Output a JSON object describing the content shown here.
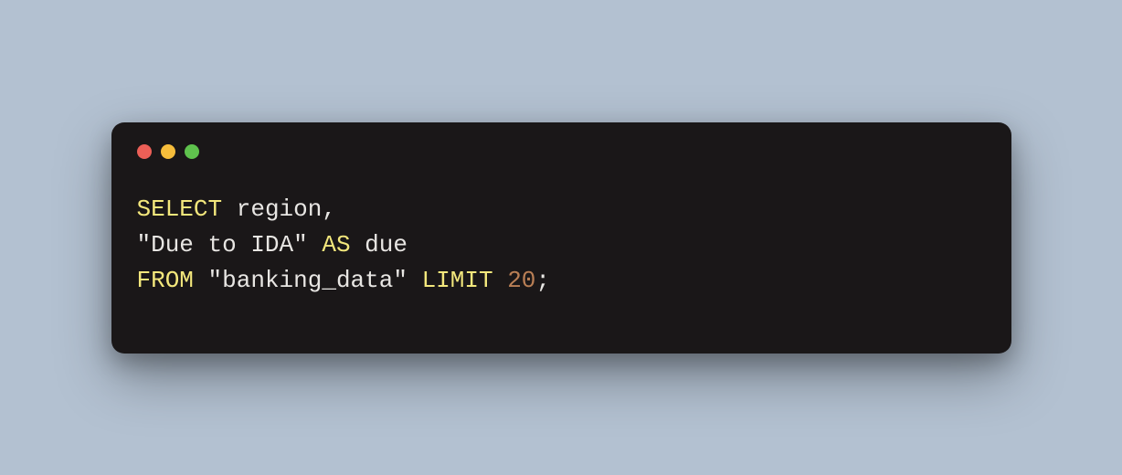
{
  "window": {
    "buttons": {
      "close": "close",
      "minimize": "minimize",
      "zoom": "zoom"
    }
  },
  "code": {
    "line1": {
      "kw_select": "SELECT",
      "sp1": " ",
      "region": "region",
      "comma": ","
    },
    "line2": {
      "str_due": "\"Due to IDA\"",
      "sp1": " ",
      "kw_as": "AS",
      "sp2": " ",
      "alias": "due"
    },
    "line3": {
      "kw_from": "FROM",
      "sp1": " ",
      "tbl": "\"banking_data\"",
      "sp2": " ",
      "kw_limit": "LIMIT",
      "sp3": " ",
      "num": "20",
      "semi": ";"
    }
  }
}
